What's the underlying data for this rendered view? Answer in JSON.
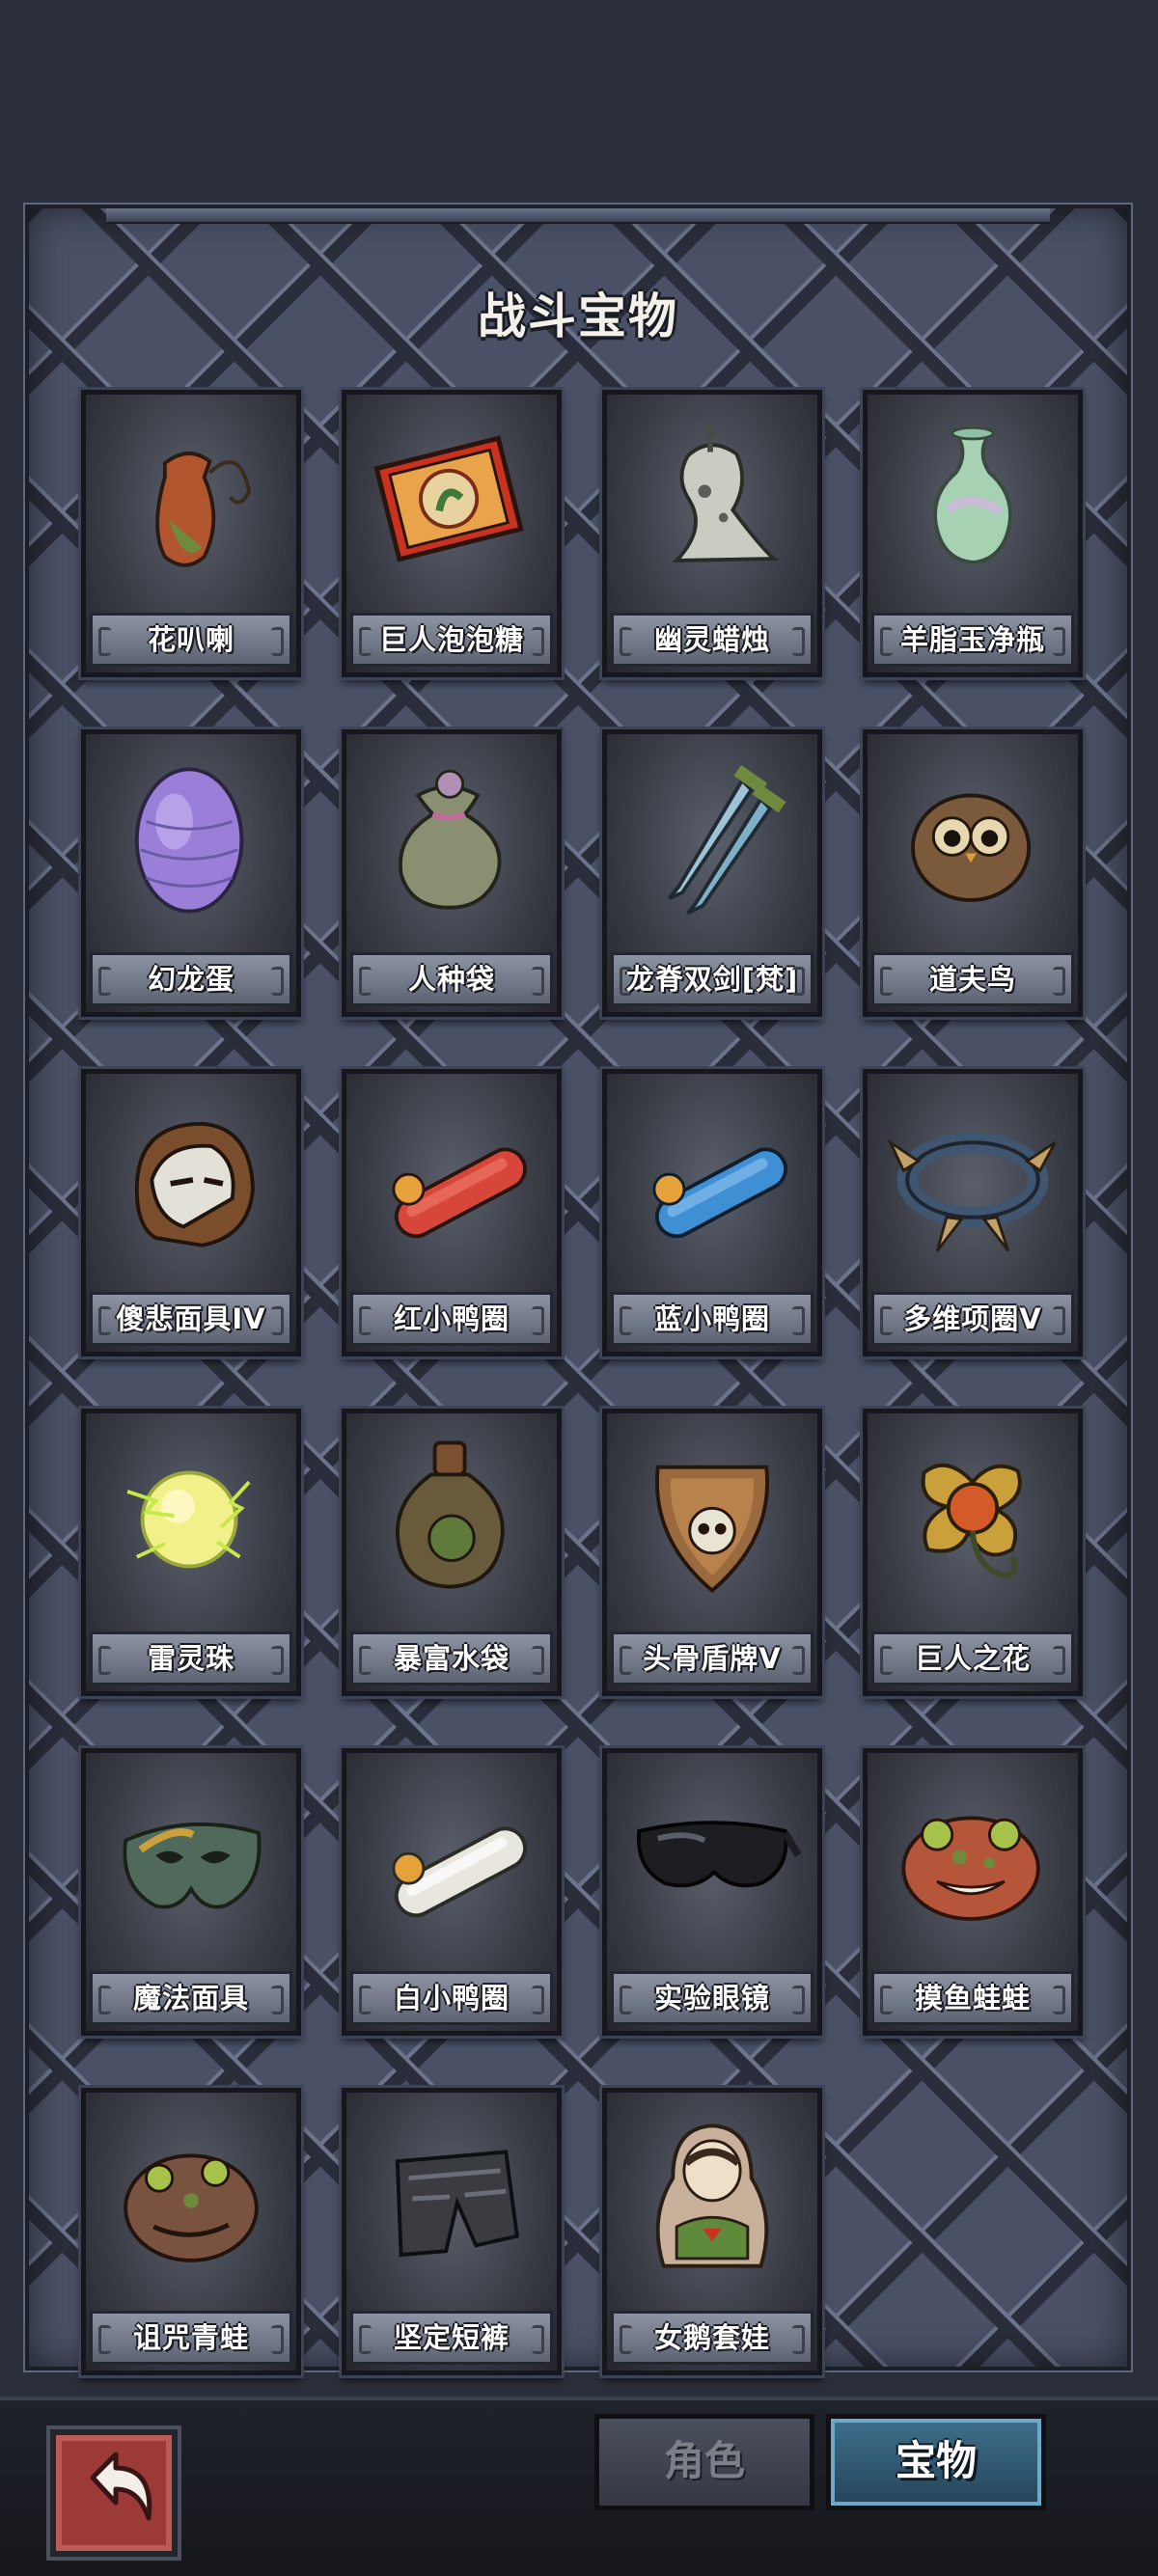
{
  "panel": {
    "title": "战斗宝物"
  },
  "items": [
    {
      "name": "花叭喇",
      "icon": "pitcher-plant-icon"
    },
    {
      "name": "巨人泡泡糖",
      "icon": "bubble-gum-box-icon"
    },
    {
      "name": "幽灵蜡烛",
      "icon": "ghost-candle-icon"
    },
    {
      "name": "羊脂玉净瓶",
      "icon": "jade-vase-icon"
    },
    {
      "name": "幻龙蛋",
      "icon": "dragon-egg-icon"
    },
    {
      "name": "人种袋",
      "icon": "cloth-sack-icon"
    },
    {
      "name": "龙脊双剑[梵]",
      "icon": "twin-swords-icon"
    },
    {
      "name": "道夫鸟",
      "icon": "owl-bird-icon"
    },
    {
      "name": "傻悲面具IV",
      "icon": "helmet-mask-icon"
    },
    {
      "name": "红小鸭圈",
      "icon": "red-duck-ring-icon"
    },
    {
      "name": "蓝小鸭圈",
      "icon": "blue-duck-ring-icon"
    },
    {
      "name": "多维项圈V",
      "icon": "spiked-collar-icon"
    },
    {
      "name": "雷灵珠",
      "icon": "thunder-orb-icon"
    },
    {
      "name": "暴富水袋",
      "icon": "water-flask-icon"
    },
    {
      "name": "头骨盾牌V",
      "icon": "skull-shield-icon"
    },
    {
      "name": "巨人之花",
      "icon": "giant-flower-icon"
    },
    {
      "name": "魔法面具",
      "icon": "magic-mask-icon"
    },
    {
      "name": "白小鸭圈",
      "icon": "white-duck-ring-icon"
    },
    {
      "name": "实验眼镜",
      "icon": "lab-goggles-icon"
    },
    {
      "name": "摸鱼蛙蛙",
      "icon": "lazy-frog-icon"
    },
    {
      "name": "诅咒青蛙",
      "icon": "cursed-frog-icon"
    },
    {
      "name": "坚定短裤",
      "icon": "armored-shorts-icon"
    },
    {
      "name": "女鹅套娃",
      "icon": "nesting-doll-icon"
    }
  ],
  "bottom_bar": {
    "back_icon": "back-arrow-icon",
    "tabs": [
      {
        "label": "角色",
        "active": false
      },
      {
        "label": "宝物",
        "active": true
      }
    ]
  },
  "colors": {
    "panel_bg": "#4a5166",
    "label_bg": "#7a8192",
    "active_tab": "#2f5a75",
    "back_button": "#9c3a38"
  }
}
